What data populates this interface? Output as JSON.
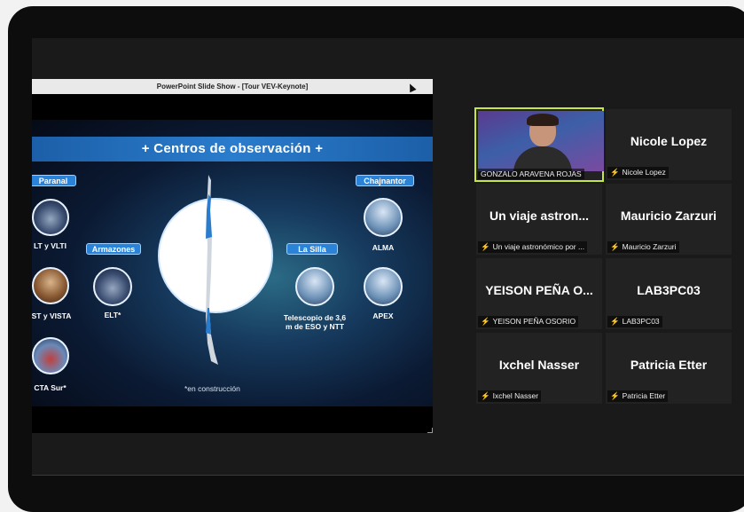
{
  "window_title": "PowerPoint Slide Show - [Tour VEV-Keynote]",
  "slide": {
    "title": "+ Centros de observación +",
    "regions": {
      "paranal": "Paranal",
      "armazones": "Armazones",
      "la_silla": "La Silla",
      "chajnantor": "Chajnantor"
    },
    "labels": {
      "vlt": "LT y VLTI",
      "vista": "ST y VISTA",
      "cta": "CTA Sur*",
      "elt": "ELT*",
      "eso36": "Telescopio de 3,6 m de ESO y NTT",
      "alma": "ALMA",
      "apex": "APEX"
    },
    "footnote": "*en construcción"
  },
  "colors": {
    "active_speaker": "#c6e646",
    "muted": "#e64545",
    "banner": "#2a7ccc"
  },
  "participants": [
    {
      "display": "",
      "caption": "GONZALO ARAVENA ROJAS",
      "muted": false,
      "video": true,
      "active": true
    },
    {
      "display": "Nicole Lopez",
      "caption": "Nicole Lopez",
      "muted": true
    },
    {
      "display": "Un viaje astron...",
      "caption": "Un viaje astronómico por ...",
      "muted": true
    },
    {
      "display": "Mauricio Zarzuri",
      "caption": "Mauricio Zarzuri",
      "muted": true
    },
    {
      "display": "YEISON PEÑA O...",
      "caption": "YEISON PEÑA OSORIO",
      "muted": true
    },
    {
      "display": "LAB3PC03",
      "caption": "LAB3PC03",
      "muted": true
    },
    {
      "display": "Ixchel Nasser",
      "caption": "Ixchel Nasser",
      "muted": true
    },
    {
      "display": "Patricia Etter",
      "caption": "Patricia Etter",
      "muted": true
    }
  ],
  "icons": {
    "muted": "microphone-muted-icon"
  }
}
